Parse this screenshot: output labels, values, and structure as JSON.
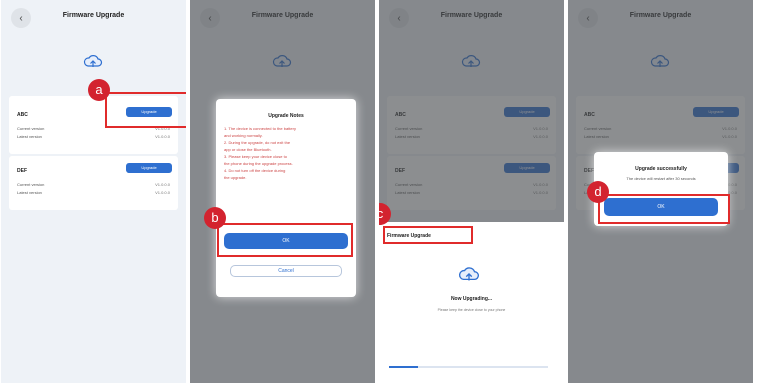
{
  "header": {
    "title": "Firmware Upgrade",
    "back_icon": "back-arrow-icon"
  },
  "devices": [
    {
      "name": "ABC",
      "button": "Upgrade",
      "rows": [
        {
          "k": "Current version",
          "v": "V1.0.0.0"
        },
        {
          "k": "Latest version",
          "v": "V1.0.0.0"
        }
      ]
    },
    {
      "name": "DEF",
      "button": "Upgrade",
      "rows": [
        {
          "k": "Current version",
          "v": "V1.0.0.0"
        },
        {
          "k": "Latest version",
          "v": "V1.0.0.0"
        }
      ]
    }
  ],
  "dialog_b": {
    "title": "Upgrade Notes",
    "lines": [
      "1. The device is connected to the battery",
      "and working normally.",
      "2. During the upgrade, do not exit the",
      "app or close the Bluetooth.",
      "3. Please keep your device close to",
      "the phone during the upgrade process.",
      "4. Do not turn off the device during",
      "the upgrade."
    ],
    "ok": "OK",
    "cancel": "Cancel"
  },
  "sheet_c": {
    "title": "Firmware Upgrade",
    "status": "Now Upgrading...",
    "detail": "Please keep the device close to your phone",
    "progress": 0.18
  },
  "dialog_d": {
    "title": "Upgrade successfully",
    "subtitle": "The device will restart after 30 seconds",
    "ok": "OK"
  },
  "badges": {
    "a": "a",
    "b": "b",
    "c": "c",
    "d": "d"
  },
  "colors": {
    "accent": "#2e6fd0",
    "highlight": "#e02b2b",
    "badge": "#d3232f"
  }
}
